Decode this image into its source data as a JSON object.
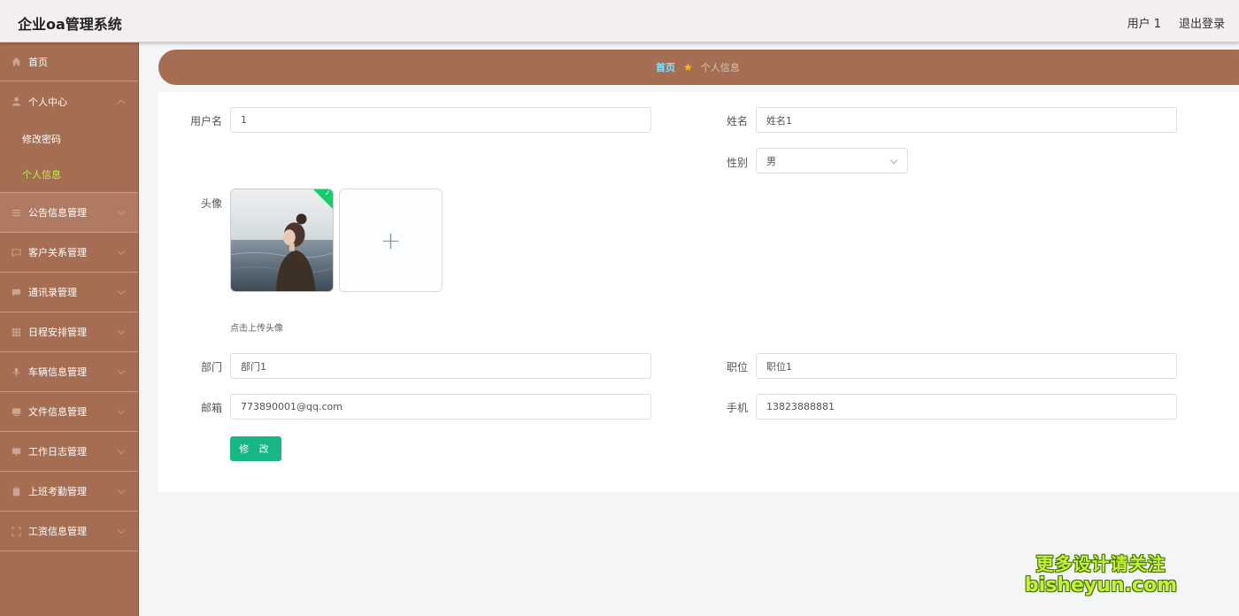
{
  "app": {
    "title": "企业oa管理系统"
  },
  "header": {
    "user": "用户 1",
    "logout": "退出登录"
  },
  "sidebar": {
    "home": {
      "label": "首页",
      "icon": "home-icon"
    },
    "personal": {
      "label": "个人中心",
      "icon": "user-icon",
      "children": [
        {
          "label": "修改密码",
          "active": false
        },
        {
          "label": "个人信息",
          "active": true
        }
      ]
    },
    "items": [
      {
        "label": "公告信息管理",
        "icon": "list-icon"
      },
      {
        "label": "客户关系管理",
        "icon": "chat-icon"
      },
      {
        "label": "通讯录管理",
        "icon": "message-icon"
      },
      {
        "label": "日程安排管理",
        "icon": "grid-icon"
      },
      {
        "label": "车辆信息管理",
        "icon": "mic-icon"
      },
      {
        "label": "文件信息管理",
        "icon": "monitor-icon"
      },
      {
        "label": "工作日志管理",
        "icon": "monitor-icon"
      },
      {
        "label": "上班考勤管理",
        "icon": "clipboard-icon"
      },
      {
        "label": "工资信息管理",
        "icon": "fullscreen-icon"
      }
    ]
  },
  "breadcrumb": {
    "home": "首页",
    "current": "个人信息"
  },
  "form": {
    "username": {
      "label": "用户名",
      "value": "1"
    },
    "name": {
      "label": "姓名",
      "value": "姓名1"
    },
    "gender": {
      "label": "性别",
      "value": "男"
    },
    "avatar": {
      "label": "头像",
      "hint": "点击上传头像",
      "upload_symbol": "+"
    },
    "department": {
      "label": "部门",
      "value": "部门1"
    },
    "position": {
      "label": "职位",
      "value": "职位1"
    },
    "email": {
      "label": "邮箱",
      "value": "773890001@qq.com"
    },
    "phone": {
      "label": "手机",
      "value": "13823888881"
    },
    "submit": "修 改"
  },
  "watermark": {
    "line1": "更多设计请关注",
    "line2": "bisheyun.com"
  },
  "colors": {
    "sidebar": "#a56d52",
    "active_sub": "#b7f542",
    "breadcrumb_home": "#7fe3ff",
    "submit": "#17b785",
    "check": "#13ce66"
  }
}
